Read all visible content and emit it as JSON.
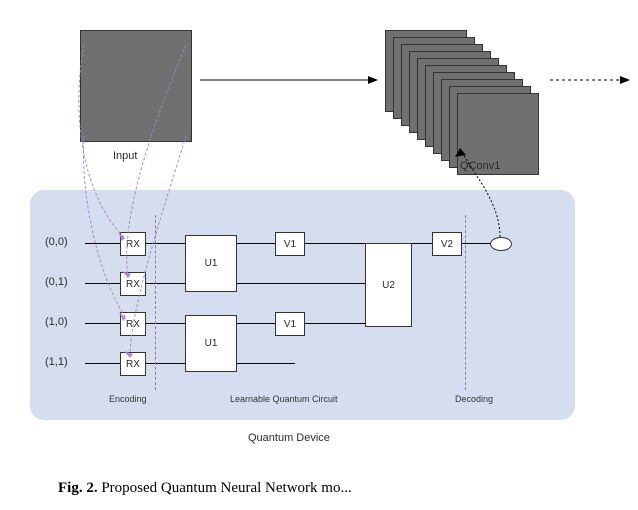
{
  "input": {
    "label": "Input"
  },
  "qconv": {
    "label": "QConv1",
    "plates": 10
  },
  "quantum_device": {
    "title": "Quantum Device",
    "coords": [
      "(0,0)",
      "(0,1)",
      "(1,0)",
      "(1,1)"
    ],
    "sections": {
      "encoding": "Encoding",
      "learnable": "Learnable Quantum Circuit",
      "decoding": "Decoding"
    },
    "gates": {
      "rx": "RX",
      "u1": "U1",
      "v1": "V1",
      "u2": "U2",
      "v2": "V2"
    }
  },
  "caption": {
    "prefix": "Fig. 2.",
    "text": " Proposed Quantum Neural Network mo..."
  }
}
